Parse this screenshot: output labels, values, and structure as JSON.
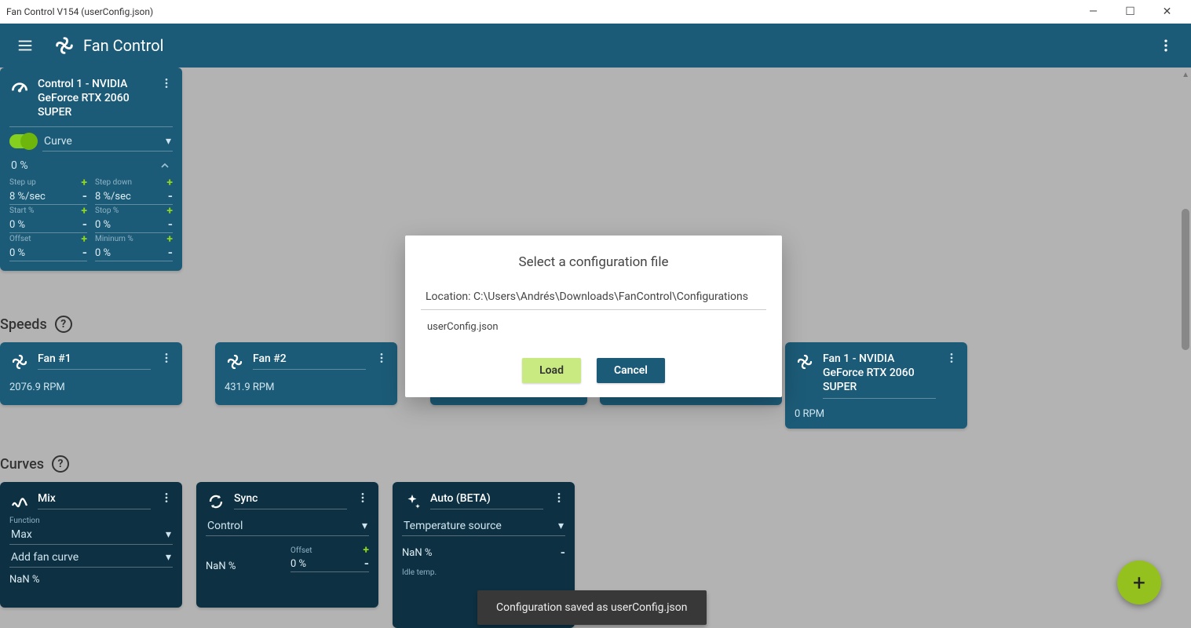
{
  "window": {
    "title": "Fan Control V154 (userConfig.json)"
  },
  "appbar": {
    "title": "Fan Control"
  },
  "control_card": {
    "title": "Control 1 - NVIDIA GeForce RTX 2060 SUPER",
    "mode": "Curve",
    "percent": "0 %",
    "step_up": {
      "label": "Step up",
      "value": "8 %/sec"
    },
    "step_down": {
      "label": "Step down",
      "value": "8 %/sec"
    },
    "start": {
      "label": "Start %",
      "value": "0 %"
    },
    "stop": {
      "label": "Stop %",
      "value": "0 %"
    },
    "offset": {
      "label": "Offset",
      "value": "0 %"
    },
    "minimum": {
      "label": "Mininum %",
      "value": "0 %"
    }
  },
  "sections": {
    "speeds": "Speeds",
    "curves": "Curves"
  },
  "speeds": [
    {
      "name": "Fan #1",
      "rpm": "2076.9 RPM"
    },
    {
      "name": "Fan #2",
      "rpm": "431.9 RPM"
    },
    {
      "name": "Fan 1 - NVIDIA GeForce RTX 2060 SUPER",
      "rpm": "0 RPM"
    }
  ],
  "curves": {
    "mix": {
      "title": "Mix",
      "function_label": "Function",
      "function_value": "Max",
      "add_label": "Add fan curve",
      "value": "NaN %"
    },
    "sync": {
      "title": "Sync",
      "control_label": "Control",
      "offset_label": "Offset",
      "offset_value": "0 %",
      "value": "NaN %"
    },
    "auto": {
      "title": "Auto (BETA)",
      "source_label": "Temperature source",
      "value": "NaN %",
      "idle_label": "Idle temp."
    }
  },
  "dialog": {
    "title": "Select a configuration file",
    "location": "Location: C:\\Users\\Andrés\\Downloads\\FanControl\\Configurations",
    "file": "userConfig.json",
    "load": "Load",
    "cancel": "Cancel"
  },
  "toast": "Configuration saved as userConfig.json"
}
